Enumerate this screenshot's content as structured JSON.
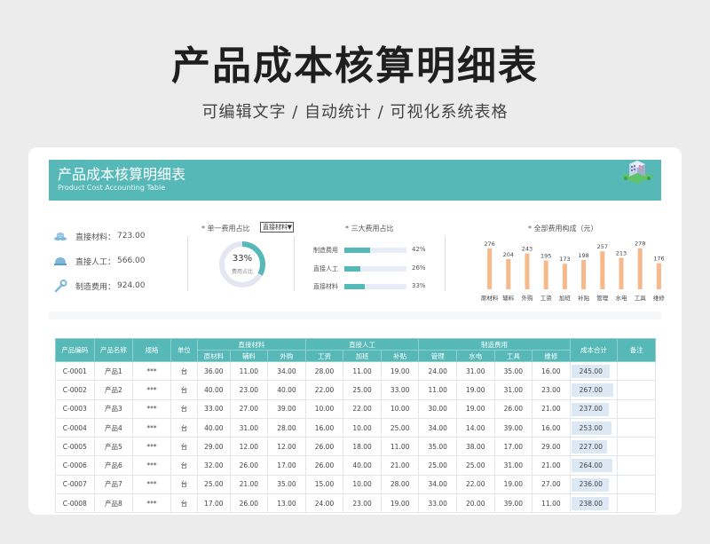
{
  "header": {
    "title": "产品成本核算明细表",
    "subtitle": "可编辑文字 / 自动统计 / 可视化系统表格"
  },
  "banner": {
    "title": "产品成本核算明细表",
    "subtitle": "Product Cost Accounting Table",
    "icon": "building-icon"
  },
  "kpis": [
    {
      "label": "直接材料：",
      "value": "723.00",
      "icon": "coins-icon"
    },
    {
      "label": "直接人工：",
      "value": "566.00",
      "icon": "hardhat-icon"
    },
    {
      "label": "制造费用：",
      "value": "924.00",
      "icon": "wrench-icon"
    }
  ],
  "single_share": {
    "title": "* 单一费用占比",
    "selected": "直接材料",
    "percent": "33%",
    "percent_value": 33,
    "label": "费用占比"
  },
  "three_share": {
    "title": "* 三大费用占比",
    "items": [
      {
        "name": "制造费用",
        "percent": "42%",
        "value": 42
      },
      {
        "name": "直接人工",
        "percent": "26%",
        "value": 26
      },
      {
        "name": "直接材料",
        "percent": "33%",
        "value": 33
      }
    ]
  },
  "chart_data": {
    "type": "bar",
    "title": "* 全部费用构成（元）",
    "categories": [
      "原材料",
      "辅料",
      "外购",
      "工资",
      "加班",
      "补贴",
      "管理",
      "水电",
      "工具",
      "维修"
    ],
    "values": [
      276,
      204,
      243,
      195,
      173,
      198,
      257,
      213,
      278,
      176
    ],
    "color": "#f5b98c"
  },
  "table": {
    "group_headers": [
      "产品编码",
      "产品名称",
      "规格",
      "单位",
      "直接材料",
      "直接人工",
      "制造费用",
      "成本合计",
      "备注"
    ],
    "sub_headers": [
      "原材料",
      "辅料",
      "外购",
      "工资",
      "加班",
      "补贴",
      "管理",
      "水电",
      "工具",
      "维修"
    ],
    "rows": [
      {
        "code": "C-0001",
        "name": "产品1",
        "spec": "***",
        "unit": "台",
        "v": [
          "36.00",
          "11.00",
          "34.00",
          "28.00",
          "11.00",
          "19.00",
          "24.00",
          "31.00",
          "35.00",
          "16.00"
        ],
        "total": "245.00",
        "total_num": 245
      },
      {
        "code": "C-0002",
        "name": "产品2",
        "spec": "***",
        "unit": "台",
        "v": [
          "40.00",
          "23.00",
          "40.00",
          "22.00",
          "25.00",
          "33.00",
          "11.00",
          "19.00",
          "31.00",
          "23.00"
        ],
        "total": "267.00",
        "total_num": 267
      },
      {
        "code": "C-0003",
        "name": "产品3",
        "spec": "***",
        "unit": "台",
        "v": [
          "33.00",
          "27.00",
          "39.00",
          "10.00",
          "22.00",
          "10.00",
          "30.00",
          "19.00",
          "26.00",
          "21.00"
        ],
        "total": "237.00",
        "total_num": 237
      },
      {
        "code": "C-0004",
        "name": "产品4",
        "spec": "***",
        "unit": "台",
        "v": [
          "40.00",
          "31.00",
          "28.00",
          "16.00",
          "10.00",
          "25.00",
          "34.00",
          "14.00",
          "39.00",
          "16.00"
        ],
        "total": "253.00",
        "total_num": 253
      },
      {
        "code": "C-0005",
        "name": "产品5",
        "spec": "***",
        "unit": "台",
        "v": [
          "29.00",
          "12.00",
          "12.00",
          "26.00",
          "18.00",
          "11.00",
          "35.00",
          "38.00",
          "17.00",
          "29.00"
        ],
        "total": "227.00",
        "total_num": 227
      },
      {
        "code": "C-0006",
        "name": "产品6",
        "spec": "***",
        "unit": "台",
        "v": [
          "32.00",
          "26.00",
          "17.00",
          "26.00",
          "40.00",
          "21.00",
          "25.00",
          "25.00",
          "31.00",
          "21.00"
        ],
        "total": "264.00",
        "total_num": 264
      },
      {
        "code": "C-0007",
        "name": "产品7",
        "spec": "***",
        "unit": "台",
        "v": [
          "25.00",
          "21.00",
          "35.00",
          "15.00",
          "10.00",
          "28.00",
          "34.00",
          "22.00",
          "19.00",
          "27.00"
        ],
        "total": "236.00",
        "total_num": 236
      },
      {
        "code": "C-0008",
        "name": "产品8",
        "spec": "***",
        "unit": "台",
        "v": [
          "17.00",
          "26.00",
          "13.00",
          "24.00",
          "23.00",
          "19.00",
          "33.00",
          "20.00",
          "39.00",
          "11.00"
        ],
        "total": "238.00",
        "total_num": 238
      }
    ]
  },
  "colors": {
    "teal": "#56b9b8",
    "orange": "#f5b98c",
    "light_blue": "#dce8f3"
  }
}
